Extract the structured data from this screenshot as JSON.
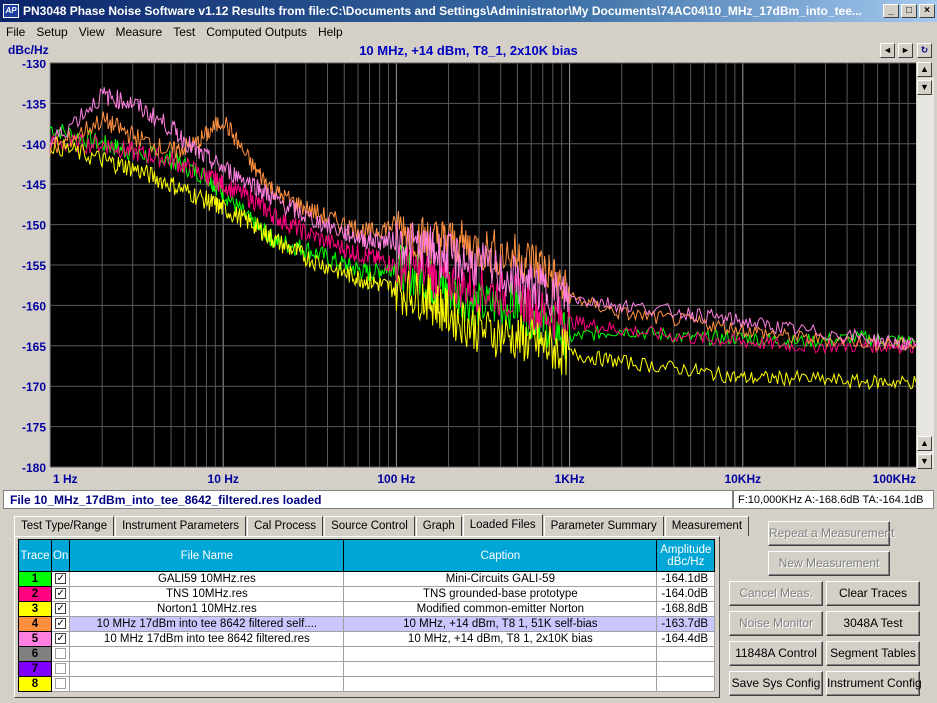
{
  "window": {
    "title": "PN3048 Phase Noise Software v1.12     Results from file:C:\\Documents and Settings\\Administrator\\My Documents\\74AC04\\10_MHz_17dBm_into_tee...",
    "icon_label": "AP",
    "min_label": "_",
    "max_label": "□",
    "close_label": "×"
  },
  "menu": [
    "File",
    "Setup",
    "View",
    "Measure",
    "Test",
    "Computed Outputs",
    "Help"
  ],
  "graph": {
    "unit_label": "dBc/Hz",
    "caption": "10 MHz, +14 dBm, T8_1, 2x10K bias",
    "scroll_left": "◄",
    "scroll_right": "►",
    "refresh_icon": "↻"
  },
  "chart_data": {
    "type": "line",
    "x_scale": "log",
    "xlim": [
      1,
      100000
    ],
    "ylim": [
      -180,
      -130
    ],
    "x_ticks": [
      1,
      10,
      100,
      1000,
      10000,
      100000
    ],
    "x_tick_labels": [
      "1 Hz",
      "10 Hz",
      "100 Hz",
      "1KHz",
      "10KHz",
      "100KHz"
    ],
    "y_ticks": [
      -130,
      -135,
      -140,
      -145,
      -150,
      -155,
      -160,
      -165,
      -170,
      -175,
      -180
    ],
    "y_tick_labels": [
      "-130",
      "-135",
      "-140",
      "-145",
      "-150",
      "-155",
      "-160",
      "-165",
      "-170",
      "-175",
      "-180"
    ],
    "grid": true,
    "background": "#000000",
    "series": [
      {
        "color": "#00ff00",
        "x": [
          1,
          2,
          3,
          5,
          8,
          10,
          15,
          20,
          30,
          50,
          70,
          100,
          150,
          200,
          300,
          500,
          700,
          1000,
          2000,
          5000,
          10000,
          20000,
          50000,
          100000
        ],
        "y": [
          -138,
          -140,
          -141,
          -142,
          -144,
          -146,
          -150,
          -152,
          -153,
          -155,
          -156,
          -155,
          -157,
          -158,
          -160,
          -160,
          -162,
          -164,
          -163,
          -164,
          -164,
          -164.5,
          -164,
          -164.5
        ]
      },
      {
        "color": "#ff0080",
        "x": [
          1,
          2,
          3,
          5,
          8,
          10,
          15,
          20,
          30,
          50,
          70,
          100,
          150,
          200,
          300,
          500,
          700,
          1000,
          2000,
          5000,
          10000,
          20000,
          50000,
          100000
        ],
        "y": [
          -140,
          -140,
          -141,
          -142,
          -144,
          -145,
          -147,
          -149,
          -151,
          -153,
          -154,
          -155,
          -156,
          -157,
          -158,
          -159,
          -161,
          -162,
          -163,
          -164,
          -164.5,
          -165,
          -165,
          -165
        ]
      },
      {
        "color": "#ffff00",
        "x": [
          1,
          2,
          3,
          5,
          8,
          10,
          15,
          20,
          30,
          50,
          70,
          100,
          150,
          200,
          300,
          500,
          700,
          1000,
          2000,
          5000,
          10000,
          20000,
          50000,
          100000
        ],
        "y": [
          -140,
          -142,
          -143,
          -145,
          -147,
          -148,
          -150,
          -152,
          -154,
          -156,
          -157,
          -158,
          -159,
          -161,
          -163,
          -164,
          -165,
          -166,
          -167,
          -168,
          -169,
          -169,
          -169.5,
          -169.5
        ]
      },
      {
        "color": "#ff9040",
        "x": [
          1,
          2,
          3,
          5,
          7,
          10,
          15,
          20,
          30,
          50,
          70,
          100,
          150,
          200,
          300,
          500,
          700,
          1000,
          2000,
          5000,
          10000,
          20000,
          50000,
          100000
        ],
        "y": [
          -141,
          -137,
          -139,
          -141,
          -140,
          -137,
          -143,
          -146,
          -148,
          -150,
          -151,
          -150,
          -152,
          -152,
          -153,
          -154,
          -155,
          -159,
          -161,
          -162,
          -163,
          -164,
          -164.5,
          -165
        ]
      },
      {
        "color": "#ff80e0",
        "x": [
          1,
          2,
          3,
          5,
          7,
          10,
          15,
          20,
          30,
          50,
          70,
          100,
          150,
          200,
          300,
          500,
          700,
          1000,
          2000,
          5000,
          10000,
          20000,
          50000,
          100000
        ],
        "y": [
          -140,
          -134,
          -135,
          -138,
          -141,
          -143,
          -145,
          -147,
          -149,
          -151,
          -152,
          -152,
          -153,
          -154,
          -155,
          -157,
          -158,
          -159,
          -160,
          -161,
          -162,
          -163,
          -164,
          -165
        ]
      }
    ]
  },
  "status": {
    "left": "File  10_MHz_17dBm_into_tee_8642_filtered.res loaded",
    "right": "F:10,000KHz   A:-168.6dB  TA:-164.1dB"
  },
  "tabs": [
    "Test Type/Range",
    "Instrument Parameters",
    "Cal Process",
    "Source Control",
    "Graph",
    "Loaded Files",
    "Parameter Summary",
    "Measurement"
  ],
  "active_tab": "Loaded Files",
  "table": {
    "headers": {
      "trace": "Trace",
      "on": "On",
      "file_name": "File Name",
      "caption": "Caption",
      "amplitude": "Amplitude dBc/Hz"
    },
    "rows": [
      {
        "trace": "1",
        "color": "#00ff00",
        "on": true,
        "file_name": "GALI59  10MHz.res",
        "caption": "Mini-Circuits GALI-59",
        "amplitude": "-164.1dB"
      },
      {
        "trace": "2",
        "color": "#ff0080",
        "on": true,
        "file_name": "TNS  10MHz.res",
        "caption": "TNS grounded-base prototype",
        "amplitude": "-164.0dB"
      },
      {
        "trace": "3",
        "color": "#ffff00",
        "on": true,
        "file_name": "Norton1  10MHz.res",
        "caption": "Modified common-emitter Norton",
        "amplitude": "-168.8dB"
      },
      {
        "trace": "4",
        "color": "#ff9040",
        "on": true,
        "file_name": "10  MHz  17dBm  into  tee  8642  filtered  self....",
        "caption": "10 MHz, +14 dBm, T8  1, 51K self-bias",
        "amplitude": "-163.7dB"
      },
      {
        "trace": "5",
        "color": "#ff80e0",
        "on": true,
        "file_name": "10  MHz  17dBm  into  tee  8642  filtered.res",
        "caption": "10 MHz, +14 dBm, T8  1, 2x10K bias",
        "amplitude": "-164.4dB"
      },
      {
        "trace": "6",
        "color": "#808080",
        "on": false,
        "file_name": "",
        "caption": "",
        "amplitude": ""
      },
      {
        "trace": "7",
        "color": "#8000ff",
        "on": false,
        "file_name": "",
        "caption": "",
        "amplitude": ""
      },
      {
        "trace": "8",
        "color": "#ffff00",
        "on": false,
        "file_name": "",
        "caption": "",
        "amplitude": ""
      }
    ]
  },
  "buttons": {
    "repeat": "Repeat a Measurement",
    "new": "New Measurement",
    "cancel": "Cancel Meas.",
    "clear": "Clear Traces",
    "noise_monitor": "Noise Monitor",
    "test_3048a": "3048A Test",
    "control_11848a": "11848A Control",
    "segment_tables": "Segment Tables",
    "save_sys": "Save Sys Config",
    "instrument_config": "Instrument Config"
  }
}
